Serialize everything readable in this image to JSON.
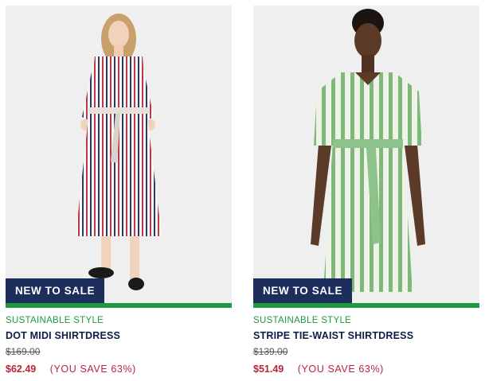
{
  "products": [
    {
      "badge": "NEW TO SALE",
      "eyebrow": "SUSTAINABLE STYLE",
      "name": "DOT MIDI SHIRTDRESS",
      "original_price": "$169.00",
      "sale_price": "$62.49",
      "savings": "(YOU SAVE 63%)"
    },
    {
      "badge": "NEW TO SALE",
      "eyebrow": "SUSTAINABLE STYLE",
      "name": "STRIPE TIE-WAIST SHIRTDRESS",
      "original_price": "$139.00",
      "sale_price": "$51.49",
      "savings": "(YOU SAVE 63%)"
    }
  ],
  "colors": {
    "badge_bg": "#1d2d5c",
    "accent_green": "#1c9a3d",
    "sale_red": "#b3263c",
    "title_navy": "#0e1d45"
  }
}
